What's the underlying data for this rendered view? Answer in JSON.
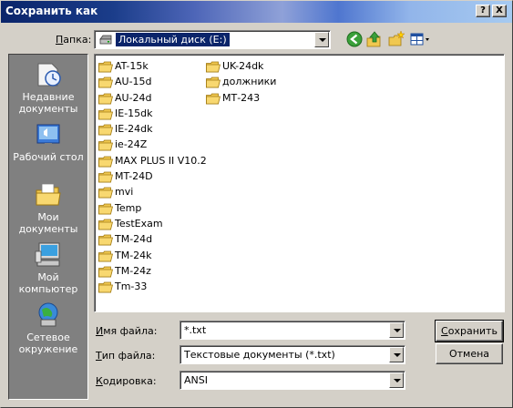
{
  "window": {
    "title": "Сохранить как",
    "help_glyph": "?",
    "close_glyph": "X"
  },
  "folder_row": {
    "label_accel": "П",
    "label_rest": "апка:",
    "current": "Локальный диск (E:)"
  },
  "toolbar": {
    "icons": [
      "back-arrow-icon",
      "up-folder-icon",
      "new-folder-icon",
      "view-menu-icon"
    ]
  },
  "places": [
    {
      "label": "Недавние документы",
      "icon": "recent-documents-icon"
    },
    {
      "label": "Рабочий стол",
      "icon": "desktop-icon"
    },
    {
      "label": "Мои документы",
      "icon": "my-documents-icon"
    },
    {
      "label": "Мой компьютер",
      "icon": "my-computer-icon"
    },
    {
      "label": "Сетевое окружение",
      "icon": "network-places-icon"
    }
  ],
  "folders_col1": [
    "AT-15k",
    "AU-15d",
    "AU-24d",
    "IE-15dk",
    "IE-24dk",
    "ie-24Z",
    "MAX PLUS II V10.2",
    "MT-24D",
    "mvi",
    "Temp",
    "TestExam",
    "TM-24d",
    "TM-24k",
    "TM-24z",
    "Tm-33"
  ],
  "folders_col2": [
    "UK-24dk",
    "должники",
    "МТ-243"
  ],
  "filename": {
    "label_accel": "И",
    "label_rest": "мя файла:",
    "value": "*.txt"
  },
  "filetype": {
    "label_accel": "Т",
    "label_rest": "ип файла:",
    "value": "Текстовые документы (*.txt)"
  },
  "encoding": {
    "label_accel": "К",
    "label_rest": "одировка:",
    "value": "ANSI"
  },
  "buttons": {
    "save_accel": "С",
    "save_rest": "охранить",
    "cancel": "Отмена"
  },
  "colors": {
    "titlebar_start": "#0a246a",
    "titlebar_end": "#a6caf0",
    "dialog_face": "#d4d0c8",
    "places_bg": "#808080",
    "selection": "#0a246a",
    "folder": "#f0c850"
  }
}
